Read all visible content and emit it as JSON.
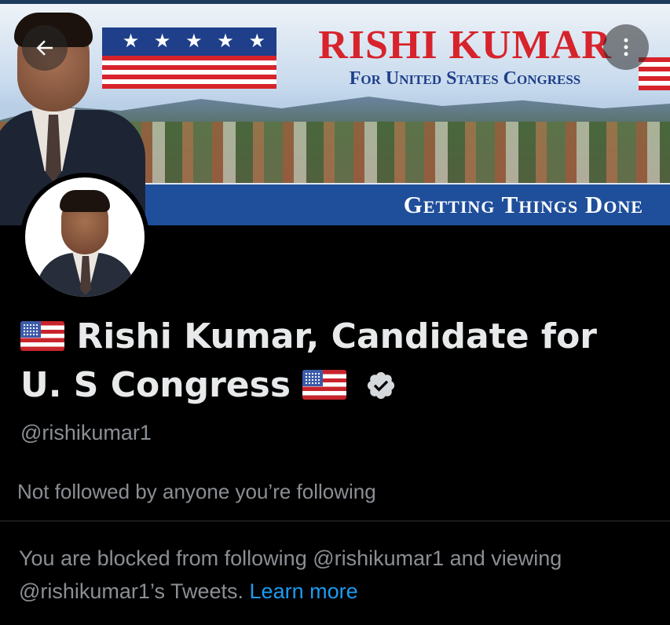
{
  "banner": {
    "stars": "★ ★ ★ ★ ★",
    "campaign_title": "RISHI KUMAR",
    "campaign_subtitle": "For United States Congress",
    "slogan": "Getting Things Done"
  },
  "header": {
    "back_icon": "arrow-left-icon",
    "more_icon": "more-icon"
  },
  "profile": {
    "name_line1": "Rishi Kumar, Candidate for",
    "name_line2": "U. S Congress",
    "handle": "@rishikumar1",
    "verified_icon": "verified-badge-icon",
    "follow_context": "Not followed by anyone you’re following"
  },
  "blocked_notice": {
    "text_part1": "You are blocked from following @rishikumar1 and viewing @rishikumar1’s Tweets.",
    "link_text": "Learn more",
    "link_color": "#1d9bf0"
  },
  "colors": {
    "background": "#000000",
    "primary_text": "#e7e9ea",
    "secondary_text": "#8b8f94",
    "divider": "#2f3336"
  }
}
